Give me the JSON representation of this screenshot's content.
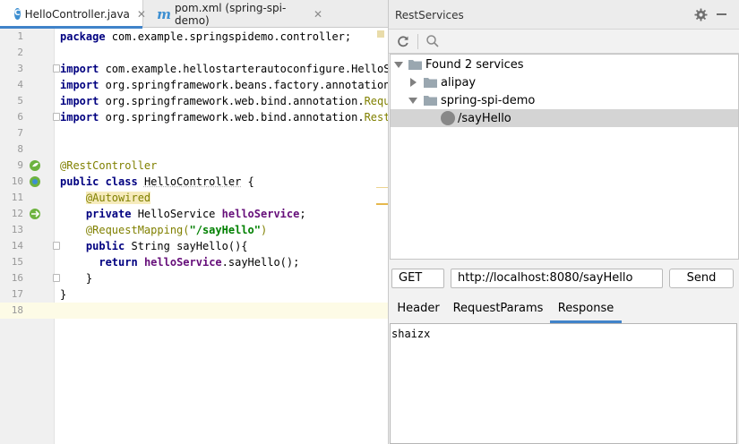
{
  "editor_tabs": [
    {
      "label": "HelloController.java",
      "icon": "java-class-icon",
      "active": true
    },
    {
      "label": "pom.xml (spring-spi-demo)",
      "icon": "maven-icon",
      "active": false
    }
  ],
  "editor": {
    "lines": [
      {
        "no": "1",
        "text": "package com.example.springspidemo.controller;"
      },
      {
        "no": "2",
        "text": ""
      },
      {
        "no": "3",
        "text": "import com.example.hellostarterautoconfigure.HelloSe"
      },
      {
        "no": "4",
        "text": "import org.springframework.beans.factory.annotation."
      },
      {
        "no": "5",
        "text": "import org.springframework.web.bind.annotation.Reques"
      },
      {
        "no": "6",
        "text": "import org.springframework.web.bind.annotation.RestCo"
      },
      {
        "no": "7",
        "text": ""
      },
      {
        "no": "8",
        "text": ""
      },
      {
        "no": "9",
        "text": "@RestController"
      },
      {
        "no": "10",
        "text": "public class HelloController {"
      },
      {
        "no": "11",
        "text": "    @Autowired"
      },
      {
        "no": "12",
        "text": "    private HelloService helloService;"
      },
      {
        "no": "13",
        "text": "    @RequestMapping(\"/sayHello\")"
      },
      {
        "no": "14",
        "text": "    public String sayHello(){"
      },
      {
        "no": "15",
        "text": "      return helloService.sayHello();"
      },
      {
        "no": "16",
        "text": "    }"
      },
      {
        "no": "17",
        "text": "}"
      },
      {
        "no": "18",
        "text": ""
      }
    ]
  },
  "rest_services": {
    "title": "RestServices",
    "settings_icon": "gear-icon",
    "toolbar": {
      "refresh_icon": "refresh-icon",
      "search_icon": "search-icon"
    },
    "tree": {
      "root": "Found 2 services",
      "services": [
        {
          "name": "alipay",
          "expanded": false,
          "endpoints": []
        },
        {
          "name": "spring-spi-demo",
          "expanded": true,
          "endpoints": [
            {
              "path": "/sayHello",
              "selected": true
            }
          ]
        }
      ]
    },
    "request": {
      "method": "GET",
      "url": "http://localhost:8080/sayHello",
      "send_label": "Send"
    },
    "response_tabs": [
      "Header",
      "RequestParams",
      "Response"
    ],
    "active_response_tab": "Response",
    "response_body": "shaizx"
  },
  "colors": {
    "keyword": "#000080",
    "annotation": "#808000",
    "string": "#008000",
    "field": "#660e7a",
    "accent": "#4083c9"
  }
}
